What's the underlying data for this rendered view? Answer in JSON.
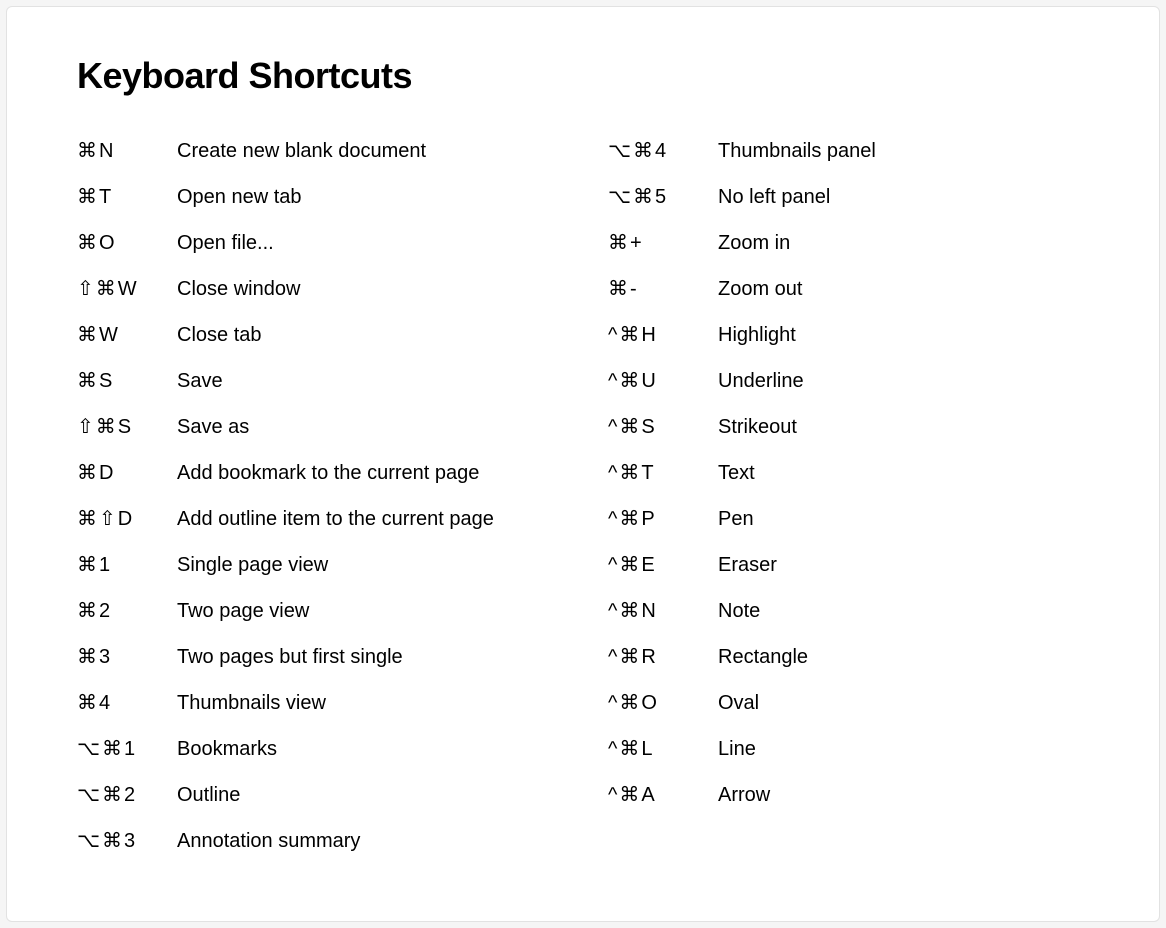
{
  "title": "Keyboard Shortcuts",
  "left": [
    {
      "keys": "⌘N",
      "desc": "Create new blank document"
    },
    {
      "keys": "⌘T",
      "desc": "Open new tab"
    },
    {
      "keys": "⌘O",
      "desc": "Open file..."
    },
    {
      "keys": "⇧⌘W",
      "desc": "Close window"
    },
    {
      "keys": "⌘W",
      "desc": "Close tab"
    },
    {
      "keys": "⌘S",
      "desc": "Save"
    },
    {
      "keys": "⇧⌘S",
      "desc": "Save as"
    },
    {
      "keys": "⌘D",
      "desc": "Add bookmark to the current page"
    },
    {
      "keys": "⌘⇧D",
      "desc": "Add outline item to the current page"
    },
    {
      "keys": "⌘1",
      "desc": "Single page view"
    },
    {
      "keys": "⌘2",
      "desc": "Two page view"
    },
    {
      "keys": "⌘3",
      "desc": "Two pages but first single"
    },
    {
      "keys": "⌘4",
      "desc": "Thumbnails view"
    },
    {
      "keys": "⌥⌘1",
      "desc": "Bookmarks"
    },
    {
      "keys": "⌥⌘2",
      "desc": "Outline"
    },
    {
      "keys": "⌥⌘3",
      "desc": "Annotation summary"
    }
  ],
  "right": [
    {
      "keys": "⌥⌘4",
      "desc": "Thumbnails panel"
    },
    {
      "keys": "⌥⌘5",
      "desc": "No left panel"
    },
    {
      "keys": "⌘+",
      "desc": "Zoom in"
    },
    {
      "keys": "⌘-",
      "desc": "Zoom out"
    },
    {
      "keys": "^⌘H",
      "desc": "Highlight"
    },
    {
      "keys": "^⌘U",
      "desc": "Underline"
    },
    {
      "keys": "^⌘S",
      "desc": "Strikeout"
    },
    {
      "keys": "^⌘T",
      "desc": "Text"
    },
    {
      "keys": "^⌘P",
      "desc": "Pen"
    },
    {
      "keys": "^⌘E",
      "desc": "Eraser"
    },
    {
      "keys": "^⌘N",
      "desc": "Note"
    },
    {
      "keys": "^⌘R",
      "desc": "Rectangle"
    },
    {
      "keys": "^⌘O",
      "desc": "Oval"
    },
    {
      "keys": "^⌘L",
      "desc": "Line"
    },
    {
      "keys": "^⌘A",
      "desc": "Arrow"
    }
  ]
}
